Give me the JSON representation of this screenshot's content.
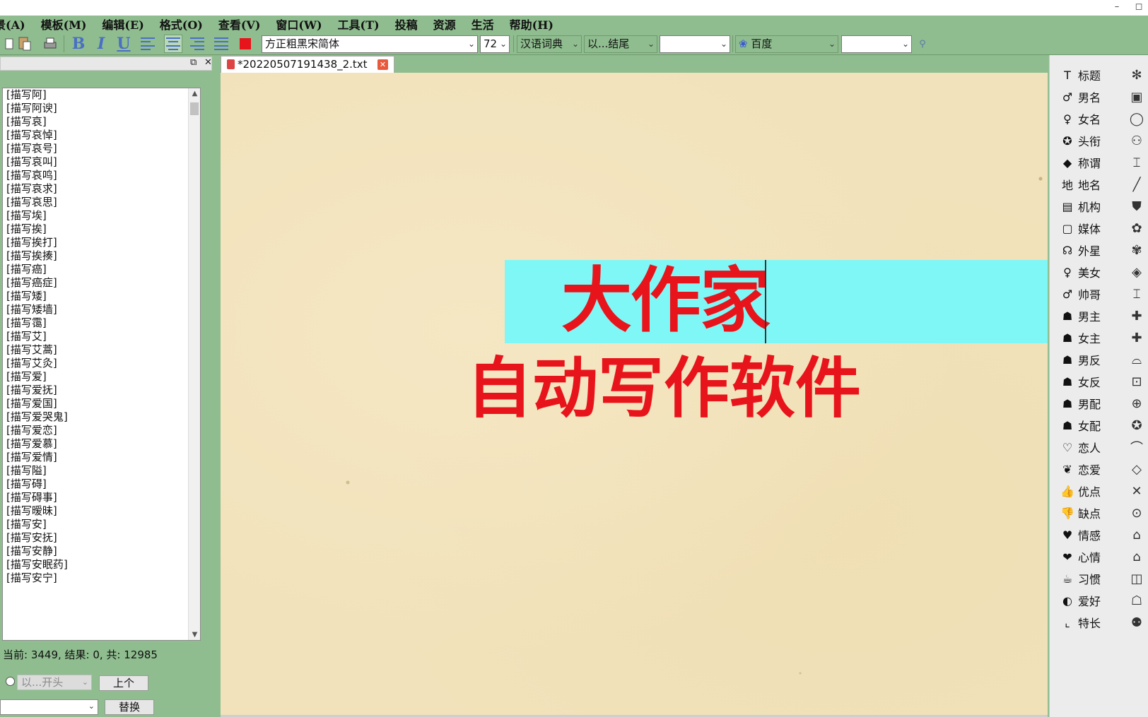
{
  "window": {
    "minimize": "–",
    "restore": "◻"
  },
  "menu": [
    "景(A)",
    "模板(M)",
    "编辑(E)",
    "格式(O)",
    "查看(V)",
    "窗口(W)",
    "工具(T)",
    "投稿",
    "资源",
    "生活",
    "帮助(H)"
  ],
  "toolbar": {
    "bold": "B",
    "italic": "I",
    "underline": "U",
    "font_name": "方正粗黑宋简体",
    "font_size": "72",
    "dictionary": "汉语词典",
    "match_mode": "以...结尾",
    "match_value": "",
    "search_engine": "百度",
    "search_value": "",
    "text_color": "#e8141b"
  },
  "left_panel": {
    "items": [
      "[描写阿]",
      "[描写阿谀]",
      "[描写哀]",
      "[描写哀悼]",
      "[描写哀号]",
      "[描写哀叫]",
      "[描写哀鸣]",
      "[描写哀求]",
      "[描写哀思]",
      "[描写埃]",
      "[描写挨]",
      "[描写挨打]",
      "[描写挨揍]",
      "[描写癌]",
      "[描写癌症]",
      "[描写矮]",
      "[描写矮墙]",
      "[描写霭]",
      "[描写艾]",
      "[描写艾蒿]",
      "[描写艾灸]",
      "[描写爱]",
      "[描写爱抚]",
      "[描写爱国]",
      "[描写爱哭鬼]",
      "[描写爱恋]",
      "[描写爱慕]",
      "[描写爱情]",
      "[描写隘]",
      "[描写碍]",
      "[描写碍事]",
      "[描写暧昧]",
      "[描写安]",
      "[描写安抚]",
      "[描写安静]",
      "[描写安眠药]",
      "[描写安宁]"
    ],
    "status": "当前: 3449, 结果: 0, 共: 12985",
    "start_mode": "以...开头",
    "prev_button": "上个",
    "replace_button": "替换"
  },
  "tab": {
    "title": "*20220507191438_2.txt"
  },
  "editor": {
    "line1": "大作家",
    "line2": "自动写作软件",
    "highlight_color": "#80f7f7",
    "text_color": "#e8141b"
  },
  "right_panel": {
    "items": [
      {
        "label": "标题",
        "icon": "title-icon",
        "glyph": "T"
      },
      {
        "label": "男名",
        "icon": "male-name-icon",
        "glyph": "♂"
      },
      {
        "label": "女名",
        "icon": "female-name-icon",
        "glyph": "♀"
      },
      {
        "label": "头衔",
        "icon": "award-icon",
        "glyph": "✪"
      },
      {
        "label": "称谓",
        "icon": "tag-icon",
        "glyph": "◆"
      },
      {
        "label": "地名",
        "icon": "location-icon",
        "glyph": "地"
      },
      {
        "label": "机构",
        "icon": "building-icon",
        "glyph": "▤"
      },
      {
        "label": "媒体",
        "icon": "media-icon",
        "glyph": "▢"
      },
      {
        "label": "外星",
        "icon": "alien-icon",
        "glyph": "☊"
      },
      {
        "label": "美女",
        "icon": "beauty-icon",
        "glyph": "♀"
      },
      {
        "label": "帅哥",
        "icon": "handsome-icon",
        "glyph": "♂"
      },
      {
        "label": "男主",
        "icon": "male-lead-icon",
        "glyph": "☗"
      },
      {
        "label": "女主",
        "icon": "female-lead-icon",
        "glyph": "☗"
      },
      {
        "label": "男反",
        "icon": "male-villain-icon",
        "glyph": "☗"
      },
      {
        "label": "女反",
        "icon": "female-villain-icon",
        "glyph": "☗"
      },
      {
        "label": "男配",
        "icon": "male-support-icon",
        "glyph": "☗"
      },
      {
        "label": "女配",
        "icon": "female-support-icon",
        "glyph": "☗"
      },
      {
        "label": "恋人",
        "icon": "heart-icon",
        "glyph": "♡"
      },
      {
        "label": "恋爱",
        "icon": "love-icon",
        "glyph": "❦"
      },
      {
        "label": "优点",
        "icon": "thumbs-up-icon",
        "glyph": "👍"
      },
      {
        "label": "缺点",
        "icon": "thumbs-down-icon",
        "glyph": "👎"
      },
      {
        "label": "情感",
        "icon": "emotion-icon",
        "glyph": "♥"
      },
      {
        "label": "心情",
        "icon": "mood-icon",
        "glyph": "❤"
      },
      {
        "label": "习惯",
        "icon": "cup-icon",
        "glyph": "☕"
      },
      {
        "label": "爱好",
        "icon": "ball-icon",
        "glyph": "◐"
      },
      {
        "label": "特长",
        "icon": "corner-icon",
        "glyph": "⌞"
      }
    ],
    "secondary_icons": [
      "✻",
      "▣",
      "◯",
      "⚇",
      "⌶",
      "╱",
      "⛊",
      "✿",
      "✾",
      "◈",
      "⌶",
      "✚",
      "✚",
      "⌓",
      "⊡",
      "⊕",
      "✪",
      "⌒",
      "◇",
      "✕",
      "⊙",
      "⌂",
      "⌂",
      "◫",
      "☖",
      "⚉"
    ]
  }
}
